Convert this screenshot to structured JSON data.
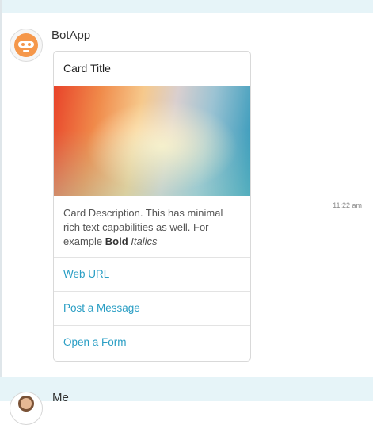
{
  "message": {
    "sender": "BotApp",
    "timestamp": "11:22 am",
    "card": {
      "title": "Card Title",
      "description_text": "Card Description. This has minimal rich text capabilities as well. For example ",
      "description_bold": "Bold",
      "description_italic": "Italics",
      "actions": [
        {
          "label": "Web URL"
        },
        {
          "label": "Post a Message"
        },
        {
          "label": "Open a Form"
        }
      ]
    }
  },
  "next_message": {
    "sender": "Me"
  },
  "colors": {
    "band": "#e6f4f8",
    "link": "#2a9ec4",
    "bot_avatar": "#f5974a"
  }
}
